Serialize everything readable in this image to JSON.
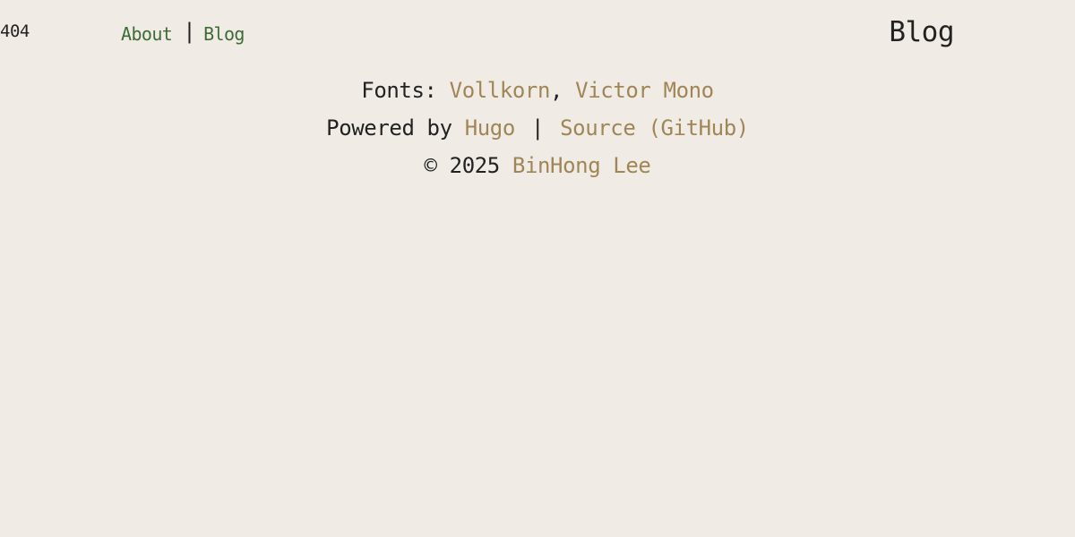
{
  "page_code": "404",
  "nav": {
    "about_label": "About",
    "separator": "|",
    "blog_label": "Blog"
  },
  "header": {
    "title": "Blog"
  },
  "footer": {
    "fonts_prefix": "Fonts: ",
    "font_1": "Vollkorn",
    "font_separator": ",",
    "font_2": "Victor Mono",
    "powered_prefix": "Powered by ",
    "powered_link": "Hugo",
    "powered_separator": "|",
    "source_link": "Source (GitHub)",
    "copyright_prefix": "© 2025 ",
    "author_link": "BinHong Lee"
  },
  "colors": {
    "background": "#f0ece5",
    "nav_link": "#3d6b35",
    "footer_link": "#a08656",
    "text": "#222222"
  }
}
